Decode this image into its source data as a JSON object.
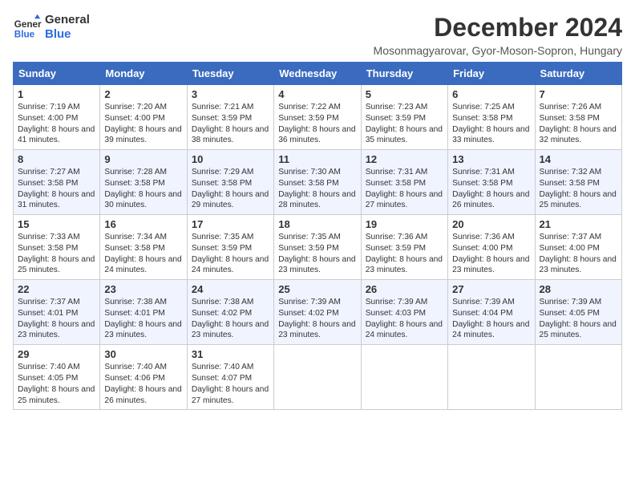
{
  "header": {
    "logo_line1": "General",
    "logo_line2": "Blue",
    "month_title": "December 2024",
    "location": "Mosonmagyarovar, Gyor-Moson-Sopron, Hungary"
  },
  "days_of_week": [
    "Sunday",
    "Monday",
    "Tuesday",
    "Wednesday",
    "Thursday",
    "Friday",
    "Saturday"
  ],
  "weeks": [
    [
      {
        "day": "1",
        "text": "Sunrise: 7:19 AM\nSunset: 4:00 PM\nDaylight: 8 hours and 41 minutes."
      },
      {
        "day": "2",
        "text": "Sunrise: 7:20 AM\nSunset: 4:00 PM\nDaylight: 8 hours and 39 minutes."
      },
      {
        "day": "3",
        "text": "Sunrise: 7:21 AM\nSunset: 3:59 PM\nDaylight: 8 hours and 38 minutes."
      },
      {
        "day": "4",
        "text": "Sunrise: 7:22 AM\nSunset: 3:59 PM\nDaylight: 8 hours and 36 minutes."
      },
      {
        "day": "5",
        "text": "Sunrise: 7:23 AM\nSunset: 3:59 PM\nDaylight: 8 hours and 35 minutes."
      },
      {
        "day": "6",
        "text": "Sunrise: 7:25 AM\nSunset: 3:58 PM\nDaylight: 8 hours and 33 minutes."
      },
      {
        "day": "7",
        "text": "Sunrise: 7:26 AM\nSunset: 3:58 PM\nDaylight: 8 hours and 32 minutes."
      }
    ],
    [
      {
        "day": "8",
        "text": "Sunrise: 7:27 AM\nSunset: 3:58 PM\nDaylight: 8 hours and 31 minutes."
      },
      {
        "day": "9",
        "text": "Sunrise: 7:28 AM\nSunset: 3:58 PM\nDaylight: 8 hours and 30 minutes."
      },
      {
        "day": "10",
        "text": "Sunrise: 7:29 AM\nSunset: 3:58 PM\nDaylight: 8 hours and 29 minutes."
      },
      {
        "day": "11",
        "text": "Sunrise: 7:30 AM\nSunset: 3:58 PM\nDaylight: 8 hours and 28 minutes."
      },
      {
        "day": "12",
        "text": "Sunrise: 7:31 AM\nSunset: 3:58 PM\nDaylight: 8 hours and 27 minutes."
      },
      {
        "day": "13",
        "text": "Sunrise: 7:31 AM\nSunset: 3:58 PM\nDaylight: 8 hours and 26 minutes."
      },
      {
        "day": "14",
        "text": "Sunrise: 7:32 AM\nSunset: 3:58 PM\nDaylight: 8 hours and 25 minutes."
      }
    ],
    [
      {
        "day": "15",
        "text": "Sunrise: 7:33 AM\nSunset: 3:58 PM\nDaylight: 8 hours and 25 minutes."
      },
      {
        "day": "16",
        "text": "Sunrise: 7:34 AM\nSunset: 3:58 PM\nDaylight: 8 hours and 24 minutes."
      },
      {
        "day": "17",
        "text": "Sunrise: 7:35 AM\nSunset: 3:59 PM\nDaylight: 8 hours and 24 minutes."
      },
      {
        "day": "18",
        "text": "Sunrise: 7:35 AM\nSunset: 3:59 PM\nDaylight: 8 hours and 23 minutes."
      },
      {
        "day": "19",
        "text": "Sunrise: 7:36 AM\nSunset: 3:59 PM\nDaylight: 8 hours and 23 minutes."
      },
      {
        "day": "20",
        "text": "Sunrise: 7:36 AM\nSunset: 4:00 PM\nDaylight: 8 hours and 23 minutes."
      },
      {
        "day": "21",
        "text": "Sunrise: 7:37 AM\nSunset: 4:00 PM\nDaylight: 8 hours and 23 minutes."
      }
    ],
    [
      {
        "day": "22",
        "text": "Sunrise: 7:37 AM\nSunset: 4:01 PM\nDaylight: 8 hours and 23 minutes."
      },
      {
        "day": "23",
        "text": "Sunrise: 7:38 AM\nSunset: 4:01 PM\nDaylight: 8 hours and 23 minutes."
      },
      {
        "day": "24",
        "text": "Sunrise: 7:38 AM\nSunset: 4:02 PM\nDaylight: 8 hours and 23 minutes."
      },
      {
        "day": "25",
        "text": "Sunrise: 7:39 AM\nSunset: 4:02 PM\nDaylight: 8 hours and 23 minutes."
      },
      {
        "day": "26",
        "text": "Sunrise: 7:39 AM\nSunset: 4:03 PM\nDaylight: 8 hours and 24 minutes."
      },
      {
        "day": "27",
        "text": "Sunrise: 7:39 AM\nSunset: 4:04 PM\nDaylight: 8 hours and 24 minutes."
      },
      {
        "day": "28",
        "text": "Sunrise: 7:39 AM\nSunset: 4:05 PM\nDaylight: 8 hours and 25 minutes."
      }
    ],
    [
      {
        "day": "29",
        "text": "Sunrise: 7:40 AM\nSunset: 4:05 PM\nDaylight: 8 hours and 25 minutes."
      },
      {
        "day": "30",
        "text": "Sunrise: 7:40 AM\nSunset: 4:06 PM\nDaylight: 8 hours and 26 minutes."
      },
      {
        "day": "31",
        "text": "Sunrise: 7:40 AM\nSunset: 4:07 PM\nDaylight: 8 hours and 27 minutes."
      },
      {
        "day": "",
        "text": ""
      },
      {
        "day": "",
        "text": ""
      },
      {
        "day": "",
        "text": ""
      },
      {
        "day": "",
        "text": ""
      }
    ]
  ]
}
